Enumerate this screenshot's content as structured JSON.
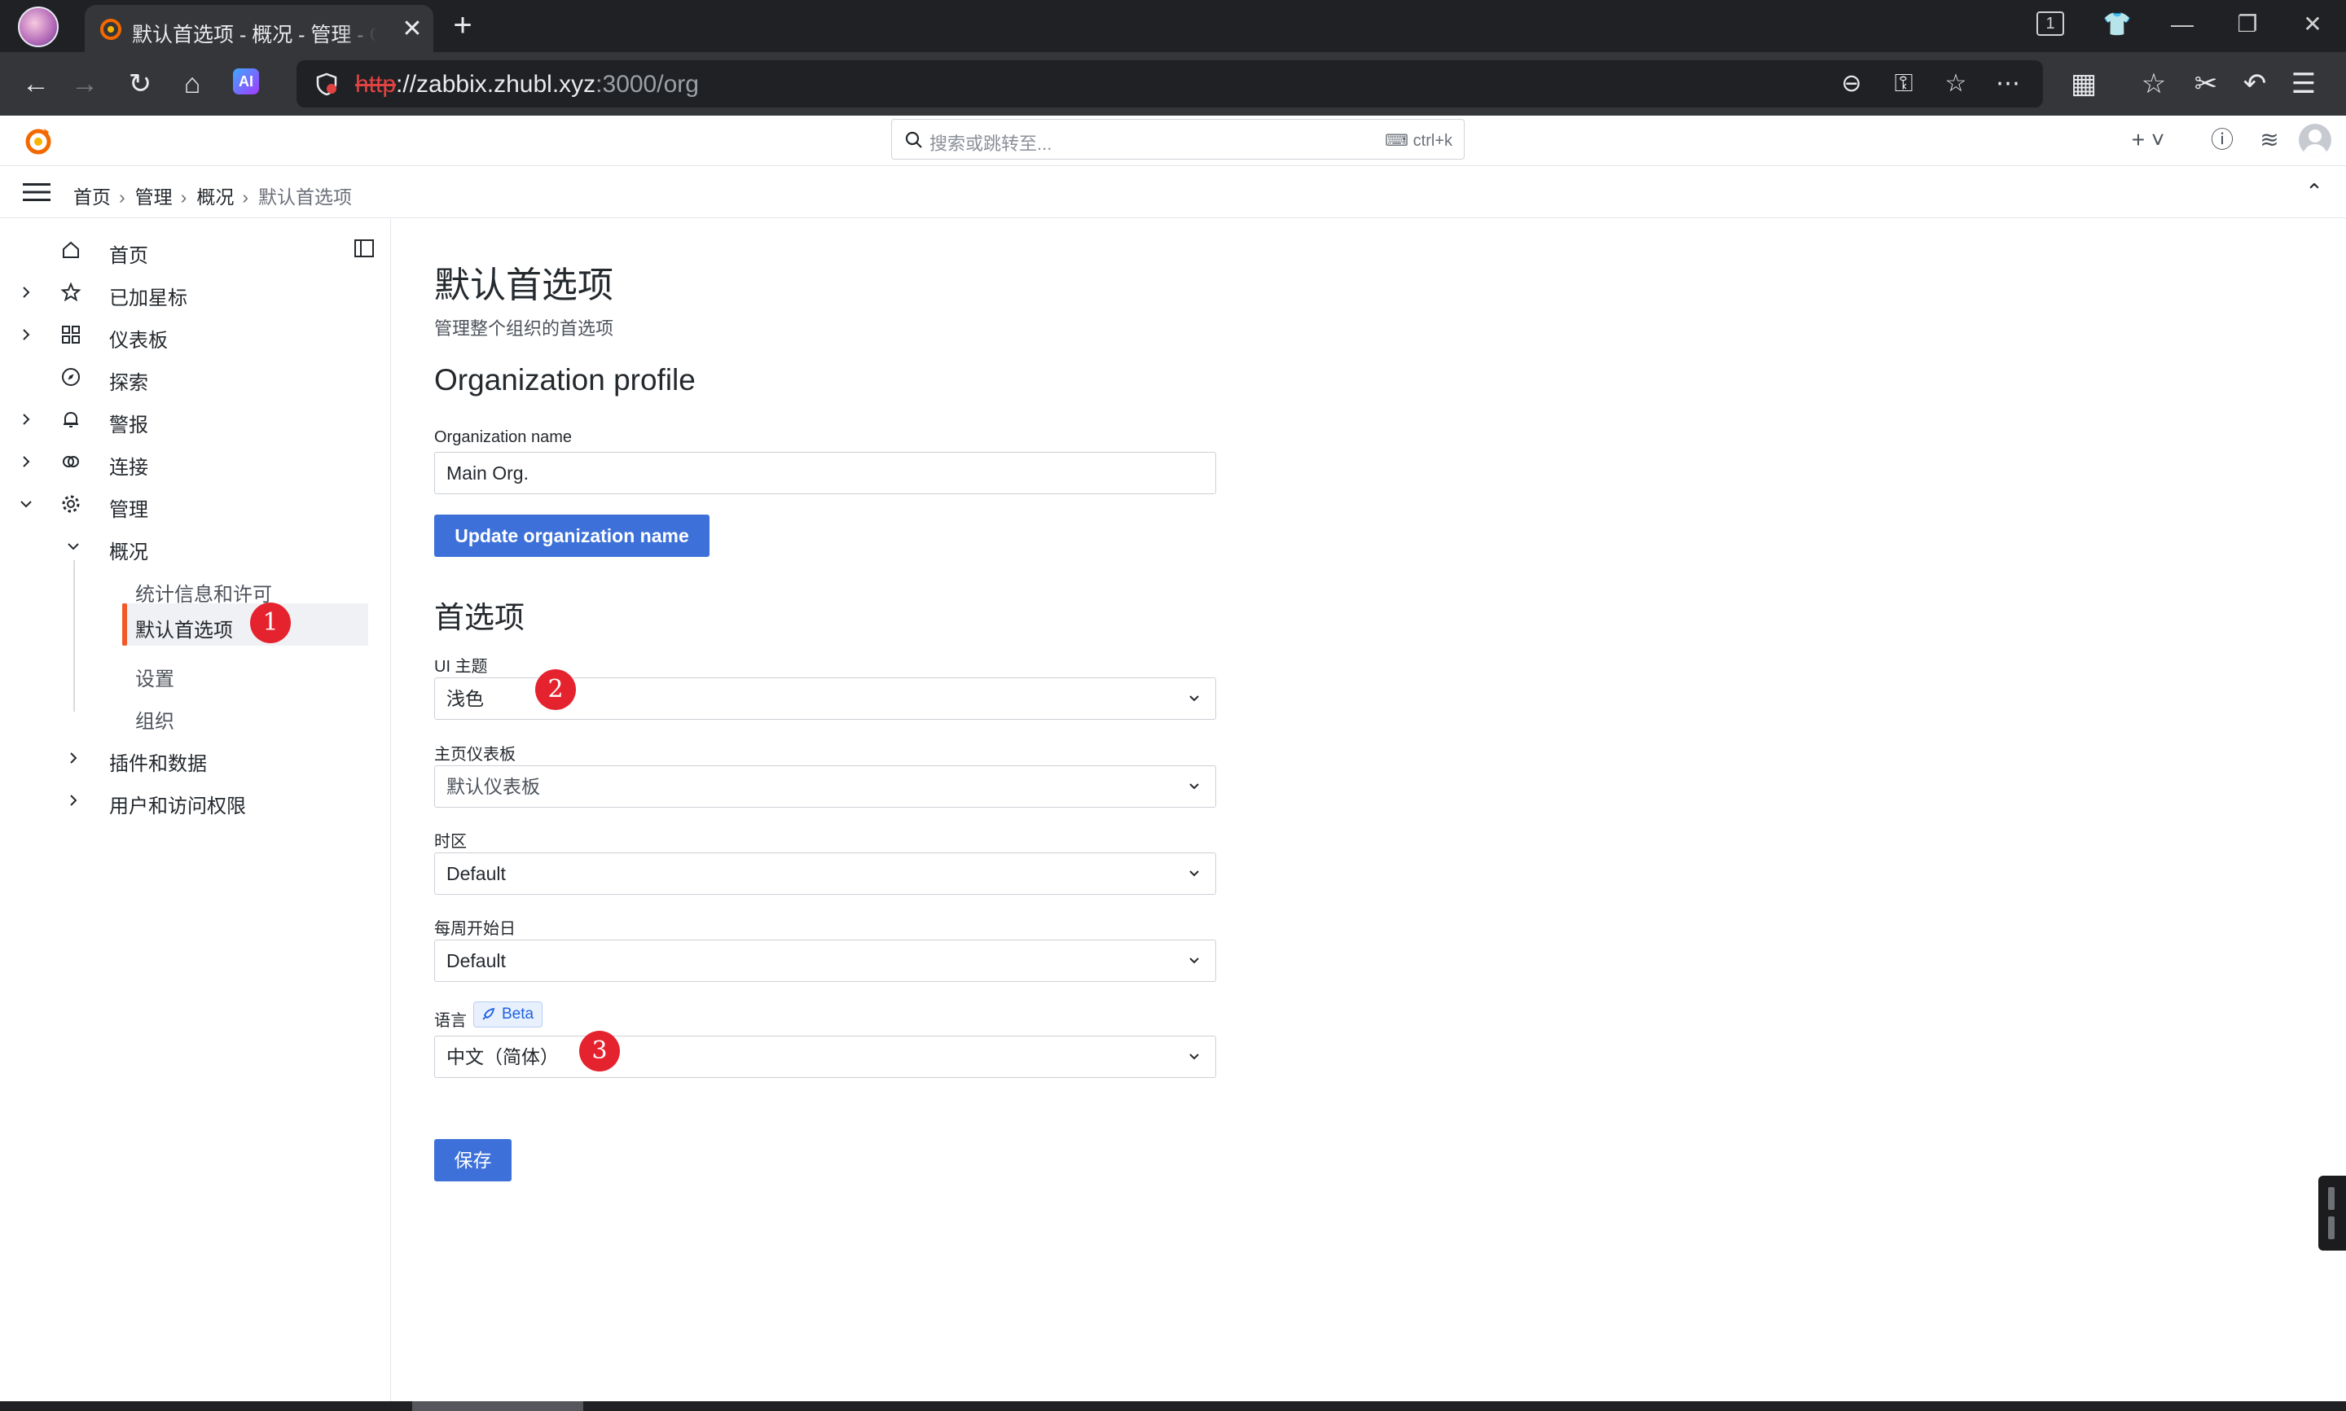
{
  "browser": {
    "tab_title": "默认首选项 - 概况 - 管理 - Grafana",
    "tab_count": "1",
    "url_protocol": "http",
    "url_host": "://zabbix.zhubl.xyz",
    "url_port_path": ":3000/org",
    "ai_label": "AI"
  },
  "search": {
    "placeholder": "搜索或跳转至...",
    "shortcut": "ctrl+k"
  },
  "breadcrumb": [
    "首页",
    "管理",
    "概况",
    "默认首选项"
  ],
  "sidebar": {
    "items": [
      {
        "label": "首页",
        "icon": "home-icon"
      },
      {
        "label": "已加星标",
        "icon": "star-icon"
      },
      {
        "label": "仪表板",
        "icon": "dashboards-icon"
      },
      {
        "label": "探索",
        "icon": "compass-icon"
      },
      {
        "label": "警报",
        "icon": "bell-icon"
      },
      {
        "label": "连接",
        "icon": "link-icon"
      },
      {
        "label": "管理",
        "icon": "gear-icon"
      }
    ],
    "admin_children": {
      "overview": "概况",
      "stats": "统计信息和许可",
      "default_prefs": "默认首选项",
      "settings": "设置",
      "orgs": "组织",
      "plugins": "插件和数据",
      "users": "用户和访问权限"
    }
  },
  "page": {
    "title": "默认首选项",
    "subtitle": "管理整个组织的首选项",
    "org_section": "Organization profile",
    "org_name_label": "Organization name",
    "org_name_value": "Main Org.",
    "update_button": "Update organization name",
    "prefs_section": "首选项",
    "ui_theme_label": "UI 主题",
    "ui_theme_value": "浅色",
    "home_dash_label": "主页仪表板",
    "home_dash_value": "默认仪表板",
    "timezone_label": "时区",
    "timezone_value": "Default",
    "week_start_label": "每周开始日",
    "week_start_value": "Default",
    "language_label": "语言",
    "beta_badge": "Beta",
    "language_value": "中文（简体）",
    "save_button": "保存"
  },
  "markers": {
    "m1": "1",
    "m2": "2",
    "m3": "3"
  },
  "colors": {
    "accent": "#3d71d9",
    "active_bar": "#f05a28",
    "marker": "#e5232f",
    "chrome_dark": "#202124"
  }
}
